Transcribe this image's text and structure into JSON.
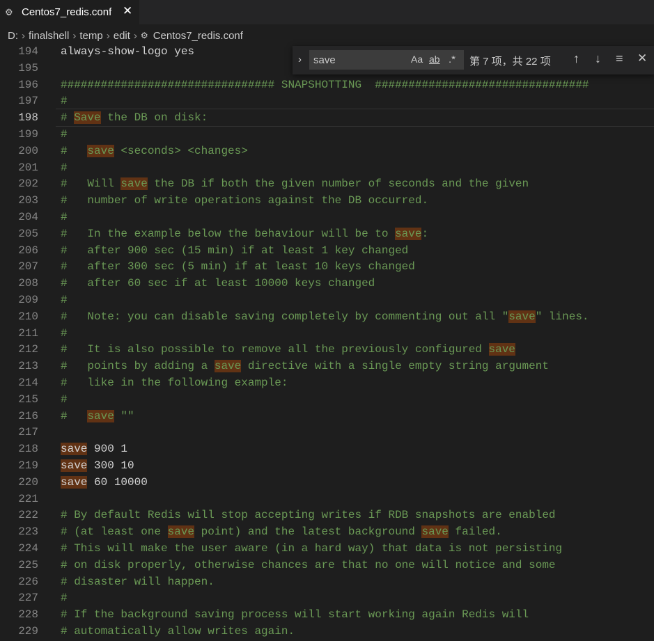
{
  "tab": {
    "icon": "gear-icon",
    "label": "Centos7_redis.conf",
    "close": "✕"
  },
  "breadcrumb": [
    "D:",
    "finalshell",
    "temp",
    "edit",
    "Centos7_redis.conf"
  ],
  "find_widget": {
    "query": "save",
    "match_case_label": "Aa",
    "whole_word_label": "ab",
    "regex_label": ".*",
    "count": "第 7 项，共 22 项",
    "prev_icon": "↑",
    "next_icon": "↓",
    "selection_icon": "≡",
    "close_icon": "✕",
    "toggle_icon": "›"
  },
  "colors": {
    "comment": "#6a9955",
    "text": "#d4d4d4",
    "match_highlight": "#613214",
    "line_number": "#858585"
  },
  "editor": {
    "current_line": 198,
    "lines": [
      {
        "n": 194,
        "t": "always-show-logo yes"
      },
      {
        "n": 195,
        "t": ""
      },
      {
        "n": 196,
        "t": "################################ SNAPSHOTTING  ################################"
      },
      {
        "n": 197,
        "t": "#"
      },
      {
        "n": 198,
        "t": "# Save the DB on disk:"
      },
      {
        "n": 199,
        "t": "#"
      },
      {
        "n": 200,
        "t": "#   save <seconds> <changes>"
      },
      {
        "n": 201,
        "t": "#"
      },
      {
        "n": 202,
        "t": "#   Will save the DB if both the given number of seconds and the given"
      },
      {
        "n": 203,
        "t": "#   number of write operations against the DB occurred."
      },
      {
        "n": 204,
        "t": "#"
      },
      {
        "n": 205,
        "t": "#   In the example below the behaviour will be to save:"
      },
      {
        "n": 206,
        "t": "#   after 900 sec (15 min) if at least 1 key changed"
      },
      {
        "n": 207,
        "t": "#   after 300 sec (5 min) if at least 10 keys changed"
      },
      {
        "n": 208,
        "t": "#   after 60 sec if at least 10000 keys changed"
      },
      {
        "n": 209,
        "t": "#"
      },
      {
        "n": 210,
        "t": "#   Note: you can disable saving completely by commenting out all \"save\" lines."
      },
      {
        "n": 211,
        "t": "#"
      },
      {
        "n": 212,
        "t": "#   It is also possible to remove all the previously configured save"
      },
      {
        "n": 213,
        "t": "#   points by adding a save directive with a single empty string argument"
      },
      {
        "n": 214,
        "t": "#   like in the following example:"
      },
      {
        "n": 215,
        "t": "#"
      },
      {
        "n": 216,
        "t": "#   save \"\""
      },
      {
        "n": 217,
        "t": ""
      },
      {
        "n": 218,
        "t": "save 900 1"
      },
      {
        "n": 219,
        "t": "save 300 10"
      },
      {
        "n": 220,
        "t": "save 60 10000"
      },
      {
        "n": 221,
        "t": ""
      },
      {
        "n": 222,
        "t": "# By default Redis will stop accepting writes if RDB snapshots are enabled"
      },
      {
        "n": 223,
        "t": "# (at least one save point) and the latest background save failed."
      },
      {
        "n": 224,
        "t": "# This will make the user aware (in a hard way) that data is not persisting"
      },
      {
        "n": 225,
        "t": "# on disk properly, otherwise chances are that no one will notice and some"
      },
      {
        "n": 226,
        "t": "# disaster will happen."
      },
      {
        "n": 227,
        "t": "#"
      },
      {
        "n": 228,
        "t": "# If the background saving process will start working again Redis will"
      },
      {
        "n": 229,
        "t": "# automatically allow writes again."
      }
    ]
  }
}
